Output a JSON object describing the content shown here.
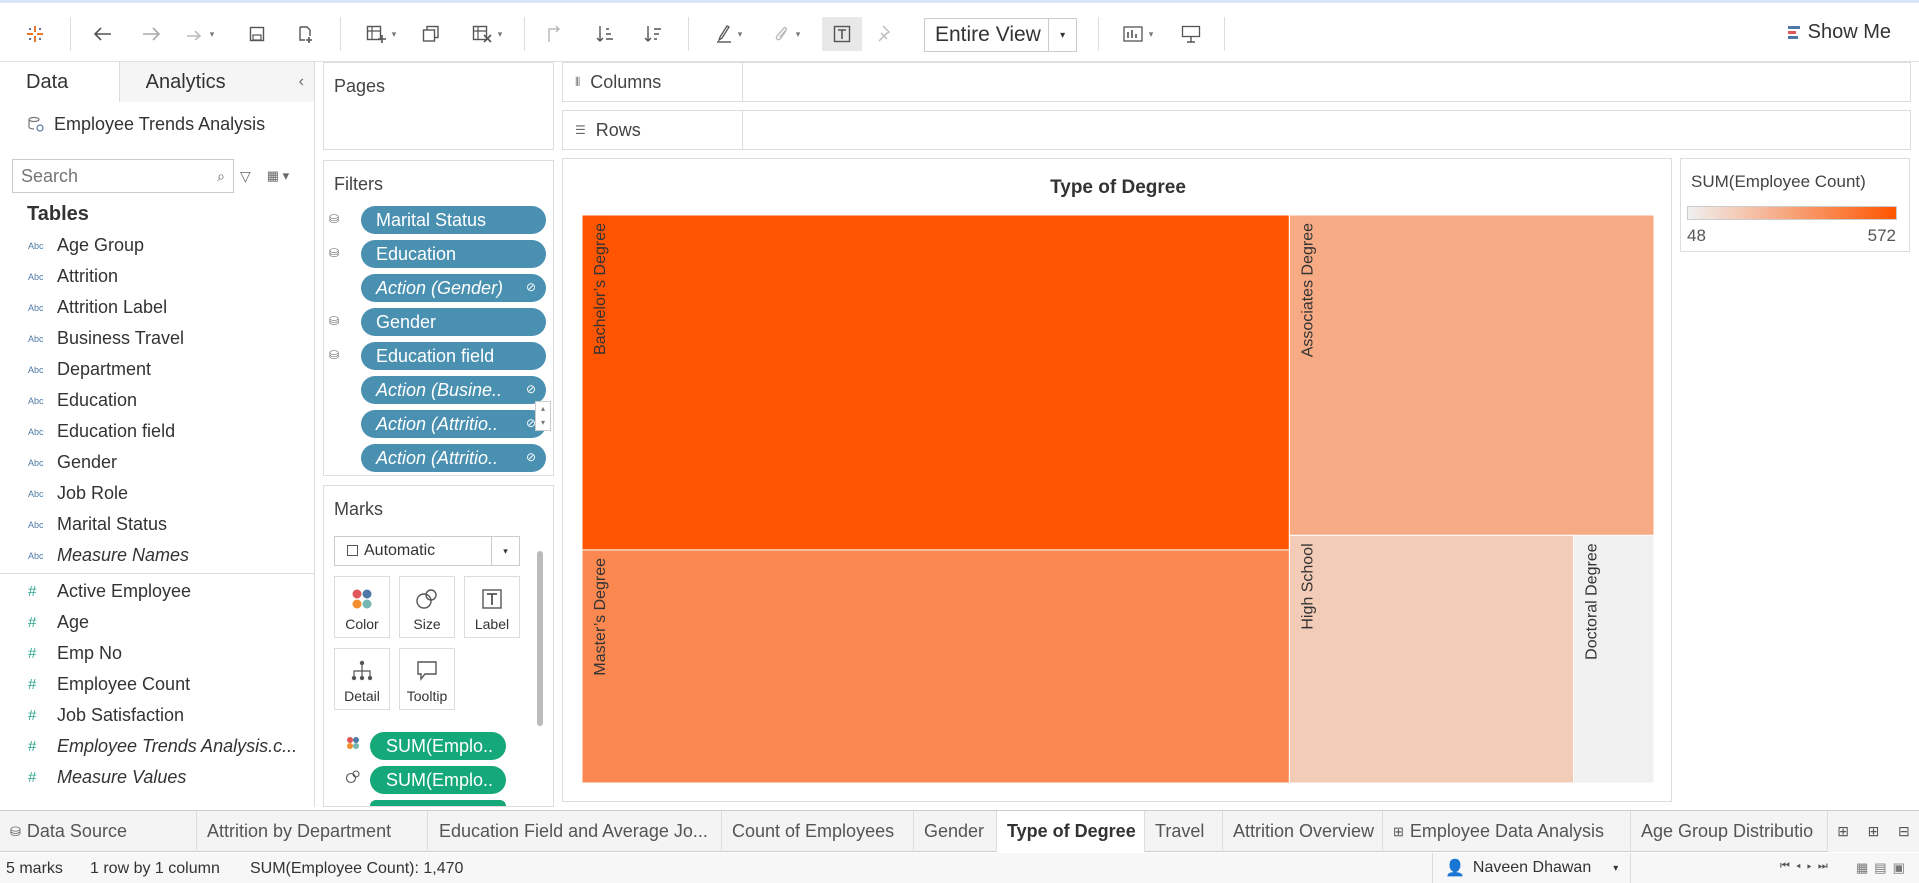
{
  "toolbar": {
    "view_select": "Entire View",
    "show_me": "Show Me"
  },
  "data_pane": {
    "tabs": [
      "Data",
      "Analytics"
    ],
    "datasource": "Employee Trends Analysis",
    "search_placeholder": "Search",
    "tables_heading": "Tables",
    "dimensions": [
      "Age Group",
      "Attrition",
      "Attrition Label",
      "Business Travel",
      "Department",
      "Education",
      "Education field",
      "Gender",
      "Job Role",
      "Marital Status",
      "Measure Names"
    ],
    "dimension_type": "Abc",
    "measures": [
      "Active Employee",
      "Age",
      "Emp No",
      "Employee Count",
      "Job Satisfaction",
      "Employee Trends Analysis.c...",
      "Measure Values"
    ],
    "measure_type": "#"
  },
  "cards": {
    "pages": "Pages",
    "filters": "Filters",
    "marks": "Marks",
    "columns": "Columns",
    "rows": "Rows"
  },
  "filters": [
    {
      "label": "Marital Status",
      "italic": false
    },
    {
      "label": "Education",
      "italic": false
    },
    {
      "label": "Action (Gender)",
      "italic": true
    },
    {
      "label": "Gender",
      "italic": false
    },
    {
      "label": "Education field",
      "italic": false
    },
    {
      "label": "Action (Busine..",
      "italic": true
    },
    {
      "label": "Action (Attritio..",
      "italic": true
    },
    {
      "label": "Action (Attritio..",
      "italic": true
    }
  ],
  "marks": {
    "type": "Automatic",
    "buttons": [
      "Color",
      "Size",
      "Label",
      "Detail",
      "Tooltip"
    ],
    "pills": [
      "SUM(Emplo..",
      "SUM(Emplo.."
    ]
  },
  "chart_data": {
    "type": "treemap",
    "title": "Type of Degree",
    "measure": "SUM(Employee Count)",
    "items": [
      {
        "label": "Bachelor’s Degree",
        "value": 572
      },
      {
        "label": "Master’s Degree",
        "value": 398
      },
      {
        "label": "Associates Degree",
        "value": 282
      },
      {
        "label": "High School",
        "value": 170
      },
      {
        "label": "Doctoral Degree",
        "value": 48
      }
    ],
    "color_range": [
      48,
      572
    ],
    "color_min": "#f0f0f0",
    "color_max": "#ff5500"
  },
  "legend": {
    "title": "SUM(Employee Count)",
    "min": "48",
    "max": "572"
  },
  "sheet_tabs": [
    {
      "label": "Data Source",
      "active": false
    },
    {
      "label": "Attrition by Department",
      "active": false
    },
    {
      "label": "Education Field and  Average Jo...",
      "active": false
    },
    {
      "label": "Count of Employees",
      "active": false
    },
    {
      "label": "Gender",
      "active": false
    },
    {
      "label": "Type of Degree",
      "active": true
    },
    {
      "label": "Travel",
      "active": false
    },
    {
      "label": "Attrition Overview",
      "active": false
    },
    {
      "label": "Employee Data Analysis",
      "active": false
    },
    {
      "label": "Age Group Distributio",
      "active": false
    }
  ],
  "status": {
    "marks": "5 marks",
    "dims": "1 row by 1 column",
    "sum": "SUM(Employee Count): 1,470",
    "user": "Naveen Dhawan"
  }
}
